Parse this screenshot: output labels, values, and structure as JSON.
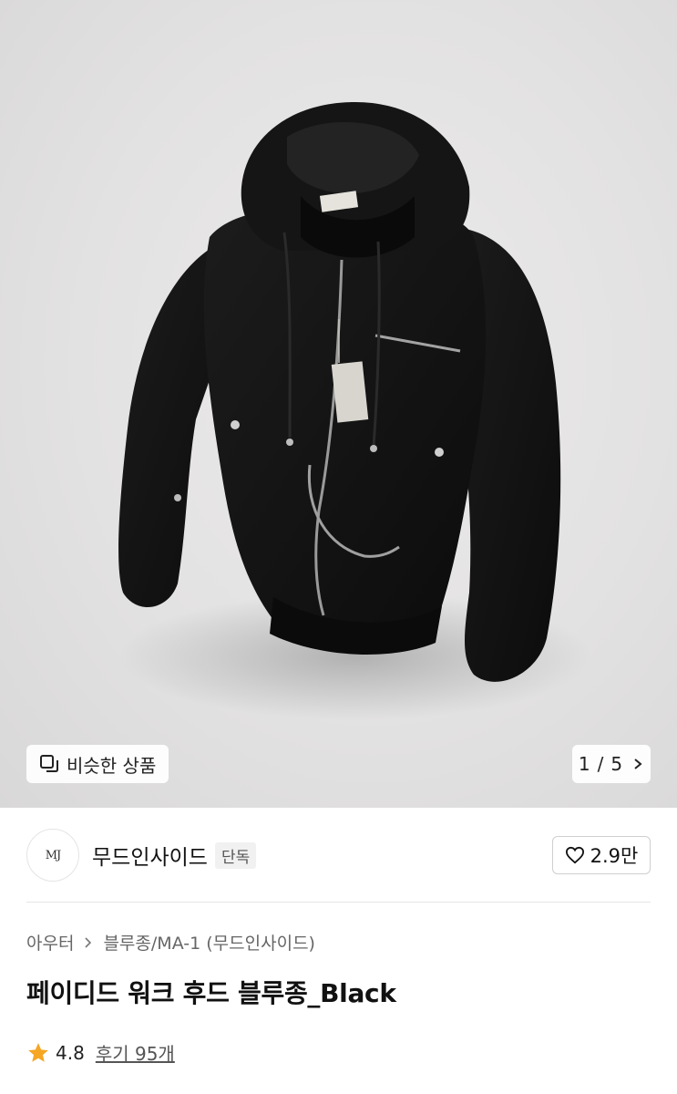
{
  "gallery": {
    "similar_label": "비슷한 상품",
    "current_page": "1",
    "separator": "/",
    "total_pages": "5"
  },
  "brand": {
    "logo_text": "MJ",
    "name": "무드인사이드",
    "badge": "단독",
    "likes": "2.9만"
  },
  "breadcrumb": {
    "category": "아우터",
    "subcategory": "블루종/MA-1 (무드인사이드)"
  },
  "product": {
    "title": "페이디드 워크 후드 블루종_Black"
  },
  "rating": {
    "score": "4.8",
    "reviews_label": "후기 95개"
  },
  "colors": {
    "star": "#F5A623",
    "jacket": "#141414"
  }
}
